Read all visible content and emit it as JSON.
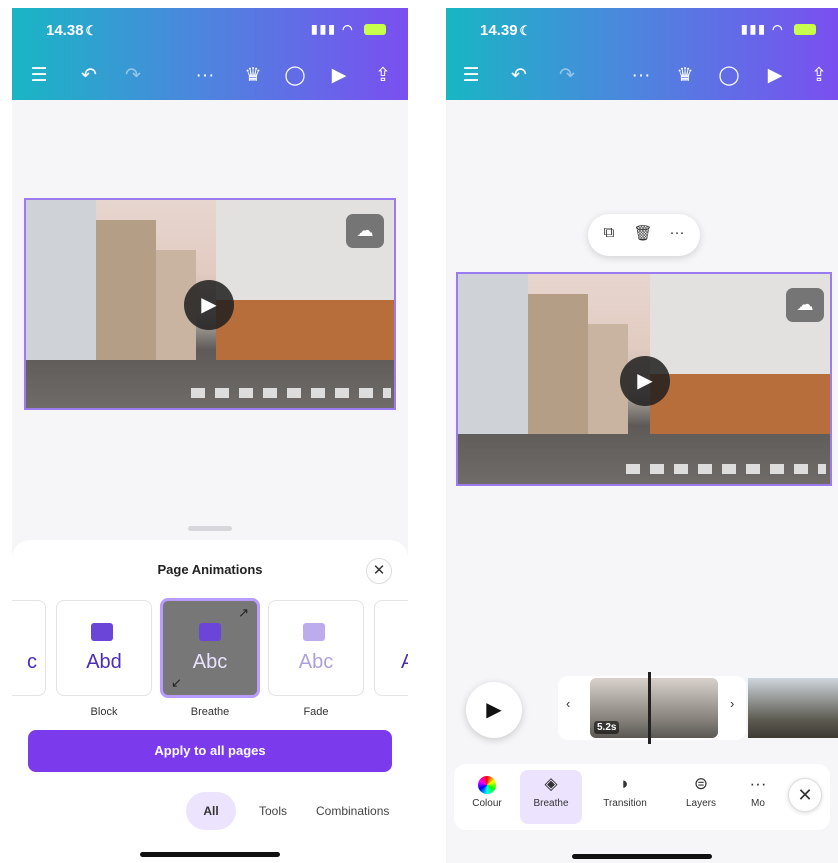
{
  "left_screen": {
    "status": {
      "time": "14.38",
      "moon_icon": "moon-icon",
      "signal_wifi_battery": "signal wifi battery"
    },
    "toolbar": {
      "menu_icon": "menu-icon",
      "undo_icon": "undo-icon",
      "redo_icon": "redo-icon",
      "more_icon": "more-horizontal-icon",
      "crown_icon": "crown-icon",
      "comment_icon": "comment-icon",
      "play_icon": "play-icon",
      "share_icon": "share-icon"
    },
    "sheet": {
      "title": "Page Animations",
      "close_symbol": "✕",
      "animations": [
        {
          "label": "",
          "text": "c"
        },
        {
          "label": "Block",
          "text": "Abd"
        },
        {
          "label": "Breathe",
          "text": "Abc",
          "selected": true
        },
        {
          "label": "Fade",
          "text": "Abc"
        },
        {
          "label": "",
          "text": "A"
        }
      ],
      "apply_button": "Apply to all pages",
      "filter_tabs": [
        "All",
        "Tools",
        "Combinations"
      ]
    }
  },
  "right_screen": {
    "status": {
      "time": "14.39"
    },
    "element_menu": {
      "copy_icon": "copy-icon",
      "delete_icon": "trash-icon",
      "more_icon": "more-horizontal-icon"
    },
    "timeline": {
      "clip_duration": "5.2s",
      "left_chevron": "‹",
      "right_chevron": "›"
    },
    "tools": [
      {
        "label": "Colour",
        "icon": "colour-wheel-icon"
      },
      {
        "label": "Breathe",
        "icon": "animate-icon",
        "active": true
      },
      {
        "label": "Transition",
        "icon": "transition-icon"
      },
      {
        "label": "Layers",
        "icon": "layers-icon"
      },
      {
        "label": "Mo",
        "icon": "more-icon"
      }
    ],
    "close_symbol": "✕"
  },
  "colors": {
    "accent": "#7c3aed",
    "selection": "#9b7cf0",
    "gradient_start": "#18b6c4",
    "gradient_end": "#7a4ff0"
  }
}
